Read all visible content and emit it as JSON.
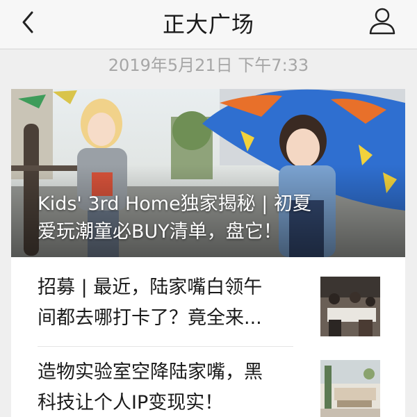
{
  "header": {
    "title": "正大广场",
    "back_icon": "chevron-left-icon",
    "profile_icon": "person-icon"
  },
  "timestamp": "2019年5月21日 下午7:33",
  "hero": {
    "title_line1": "Kids' 3rd Home独家揭秘 | 初夏",
    "title_line2": "爱玩潮童必BUY清单，盘它！"
  },
  "articles": [
    {
      "line1": "招募 | 最近，陆家嘴白领午",
      "line2": "间都去哪打卡了？竟全来..."
    },
    {
      "line1": "造物实验室空降陆家嘴，黑",
      "line2": "科技让个人IP变现实！"
    }
  ],
  "colors": {
    "navbar_bg": "#f7f7f7",
    "page_bg": "#efefef",
    "umbrella_blue": "#2f6fd0",
    "umbrella_orange": "#e8702a"
  }
}
